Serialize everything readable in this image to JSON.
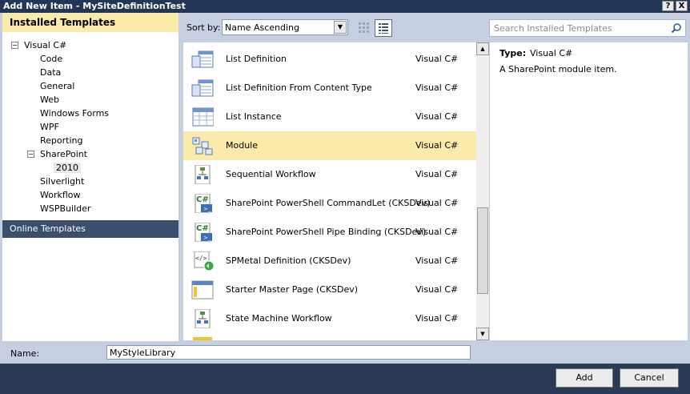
{
  "window": {
    "title": "Add New Item - MySiteDefinitionTest",
    "help_label": "?",
    "close_label": "X"
  },
  "left": {
    "header": "Installed Templates",
    "tree": [
      {
        "label": "Visual C#",
        "expander": "−"
      },
      {
        "label": "Code"
      },
      {
        "label": "Data"
      },
      {
        "label": "General"
      },
      {
        "label": "Web"
      },
      {
        "label": "Windows Forms"
      },
      {
        "label": "WPF"
      },
      {
        "label": "Reporting"
      },
      {
        "label": "SharePoint",
        "expander": "−"
      },
      {
        "label": "2010"
      },
      {
        "label": "Silverlight"
      },
      {
        "label": "Workflow"
      },
      {
        "label": "WSPBuilder"
      }
    ],
    "online": "Online Templates"
  },
  "toolbar": {
    "sort_label": "Sort by:",
    "sort_value": "Name Ascending",
    "search_placeholder": "Search Installed Templates"
  },
  "templates": [
    {
      "name": "List Definition",
      "lang": "Visual C#",
      "icon": "list-definition-icon"
    },
    {
      "name": "List Definition From Content Type",
      "lang": "Visual C#",
      "icon": "list-definition-icon"
    },
    {
      "name": "List Instance",
      "lang": "Visual C#",
      "icon": "list-instance-icon"
    },
    {
      "name": "Module",
      "lang": "Visual C#",
      "icon": "module-icon",
      "selected": true
    },
    {
      "name": "Sequential Workflow",
      "lang": "Visual C#",
      "icon": "workflow-icon"
    },
    {
      "name": "SharePoint PowerShell CommandLet (CKSDev)",
      "lang": "Visual C#",
      "icon": "csharp-file-icon"
    },
    {
      "name": "SharePoint PowerShell Pipe Binding (CKSDev)",
      "lang": "Visual C#",
      "icon": "csharp-file-icon"
    },
    {
      "name": "SPMetal Definition (CKSDev)",
      "lang": "Visual C#",
      "icon": "spmetal-icon"
    },
    {
      "name": "Starter Master Page (CKSDev)",
      "lang": "Visual C#",
      "icon": "master-page-icon"
    },
    {
      "name": "State Machine Workflow",
      "lang": "Visual C#",
      "icon": "workflow-icon"
    }
  ],
  "details": {
    "type_label": "Type:",
    "type_value": "Visual C#",
    "description": "A SharePoint module item."
  },
  "name_row": {
    "label": "Name:",
    "value": "MyStyleLibrary"
  },
  "buttons": {
    "add": "Add",
    "cancel": "Cancel"
  }
}
